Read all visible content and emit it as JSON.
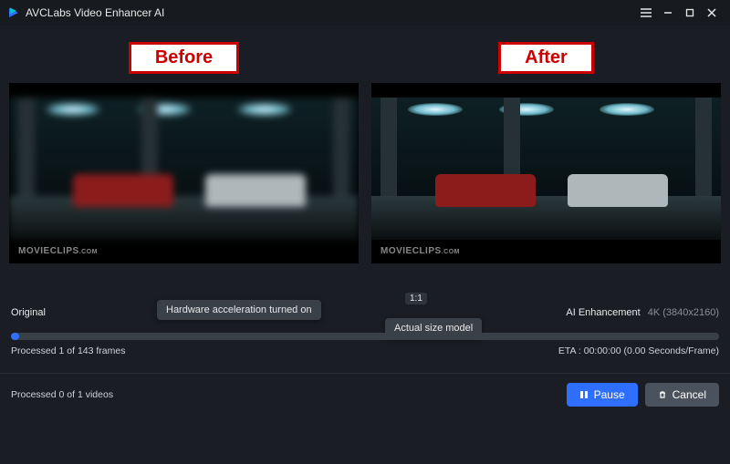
{
  "app": {
    "title": "AVCLabs Video Enhancer AI"
  },
  "compare": {
    "before_label": "Before",
    "after_label": "After",
    "watermark_brand": "MOVIECLIPS",
    "watermark_suffix": ".COM"
  },
  "mid": {
    "original_label": "Original",
    "ai_label": "AI Enhancement",
    "resolution": "4K (3840x2160)",
    "ratio_badge": "1:1",
    "tooltip_hw": "Hardware acceleration turned on",
    "tooltip_actual": "Actual size model"
  },
  "progress": {
    "frame_text": "Processed 1 of 143 frames",
    "eta_text": "ETA : 00:00:00 (0.00 Seconds/Frame)",
    "percent_value": 0.7,
    "fill_width_pct": 1.2
  },
  "bottom": {
    "video_text": "Processed 0 of 1 videos",
    "pause_label": "Pause",
    "cancel_label": "Cancel"
  },
  "colors": {
    "accent": "#2f6fff",
    "bg": "#1a1d23",
    "annotation_red": "#c00"
  }
}
